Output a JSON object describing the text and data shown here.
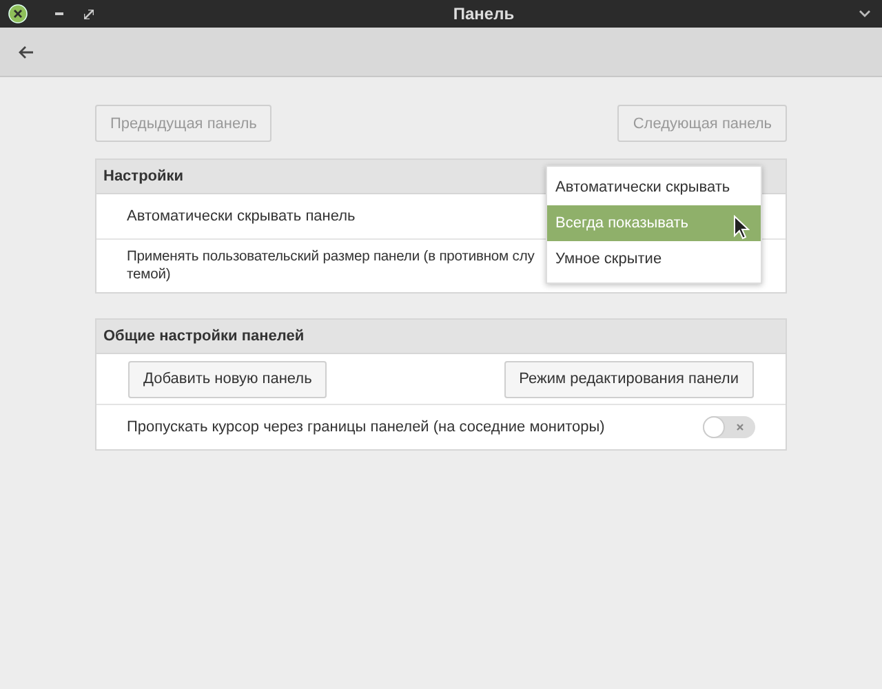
{
  "window": {
    "title": "Панель"
  },
  "nav": {
    "previous": "Предыдущая панель",
    "next": "Следующая панель"
  },
  "settings": {
    "title": "Настройки",
    "rows": [
      {
        "kind": "select",
        "label": "Автоматически скрывать панель"
      },
      {
        "kind": "wrapped",
        "label_lines": [
          "Применять пользовательский размер панели (в противном слу",
          "темой)"
        ]
      }
    ],
    "menu": [
      {
        "label": "Автоматически скрывать",
        "selected": false
      },
      {
        "label": "Всегда показывать",
        "selected": true
      },
      {
        "label": "Умное скрытие",
        "selected": false
      }
    ]
  },
  "general": {
    "title": "Общие настройки панелей",
    "buttons": [
      "Добавить новую панель",
      "Режим редактирования панели"
    ],
    "rows": [
      {
        "kind": "toggle",
        "label": "Пропускать курсор через границы панелей (на соседние мониторы)",
        "on": false
      }
    ]
  }
}
